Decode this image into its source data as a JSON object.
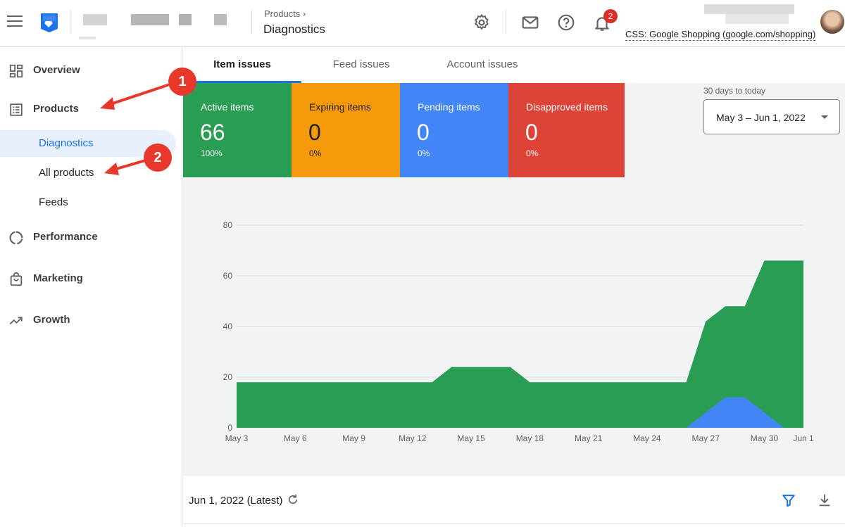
{
  "header": {
    "breadcrumb_parent": "Products",
    "breadcrumb_chevron": "›",
    "page_title": "Diagnostics",
    "notifications_count": "2",
    "account_name": "CSS: Google Shopping (google.com/shopping)",
    "icons": [
      "menu-icon",
      "merchant-center-logo",
      "settings-icon",
      "mail-icon",
      "help-icon",
      "notifications-icon"
    ]
  },
  "sidebar": {
    "items": [
      {
        "label": "Overview",
        "icon": "dashboard-icon"
      },
      {
        "label": "Products",
        "icon": "list-icon"
      },
      {
        "label": "Diagnostics",
        "active": true
      },
      {
        "label": "All products"
      },
      {
        "label": "Feeds"
      },
      {
        "label": "Performance",
        "icon": "donut-icon"
      },
      {
        "label": "Marketing",
        "icon": "shopping-bag-icon"
      },
      {
        "label": "Growth",
        "icon": "trending-up-icon"
      }
    ]
  },
  "annotations": [
    {
      "label": "1",
      "color": "#e8372b"
    },
    {
      "label": "2",
      "color": "#e8372b"
    }
  ],
  "tabs": [
    {
      "label": "Item issues",
      "active": true
    },
    {
      "label": "Feed issues"
    },
    {
      "label": "Account issues"
    }
  ],
  "tiles": [
    {
      "label": "Active items",
      "value": "66",
      "percent": "100%",
      "color": "#2a9d55"
    },
    {
      "label": "Expiring items",
      "value": "0",
      "percent": "0%",
      "color": "#f6990a"
    },
    {
      "label": "Pending items",
      "value": "0",
      "percent": "0%",
      "color": "#4286f5"
    },
    {
      "label": "Disapproved items",
      "value": "0",
      "percent": "0%",
      "color": "#dd4337"
    }
  ],
  "date_range": {
    "caption": "30 days to today",
    "value": "May 3 – Jun 1, 2022"
  },
  "chart_data": {
    "type": "area",
    "ylim": [
      0,
      80
    ],
    "yticks": [
      0,
      20,
      40,
      60,
      80
    ],
    "xticks": [
      "May 3",
      "May 6",
      "May 9",
      "May 12",
      "May 15",
      "May 18",
      "May 21",
      "May 24",
      "May 27",
      "May 30",
      "Jun 1"
    ],
    "grid": true,
    "series": [
      {
        "color": "#2a9d55",
        "x": [
          "2022-05-03",
          "2022-05-13",
          "2022-05-14",
          "2022-05-17",
          "2022-05-18",
          "2022-05-26",
          "2022-05-27",
          "2022-05-28",
          "2022-05-29",
          "2022-05-30",
          "2022-06-01"
        ],
        "y": [
          18,
          18,
          24,
          24,
          18,
          18,
          42,
          48,
          48,
          66,
          66
        ]
      },
      {
        "color": "#4286f5",
        "x": [
          "2022-05-03",
          "2022-05-26",
          "2022-05-27",
          "2022-05-28",
          "2022-05-29",
          "2022-05-30",
          "2022-05-31",
          "2022-06-01"
        ],
        "y": [
          0,
          0,
          6,
          12,
          12,
          6,
          0,
          0
        ]
      }
    ]
  },
  "footer": {
    "as_of": "Jun 1, 2022 (Latest)",
    "icons": [
      "refresh-icon",
      "filter-icon",
      "download-icon"
    ]
  }
}
